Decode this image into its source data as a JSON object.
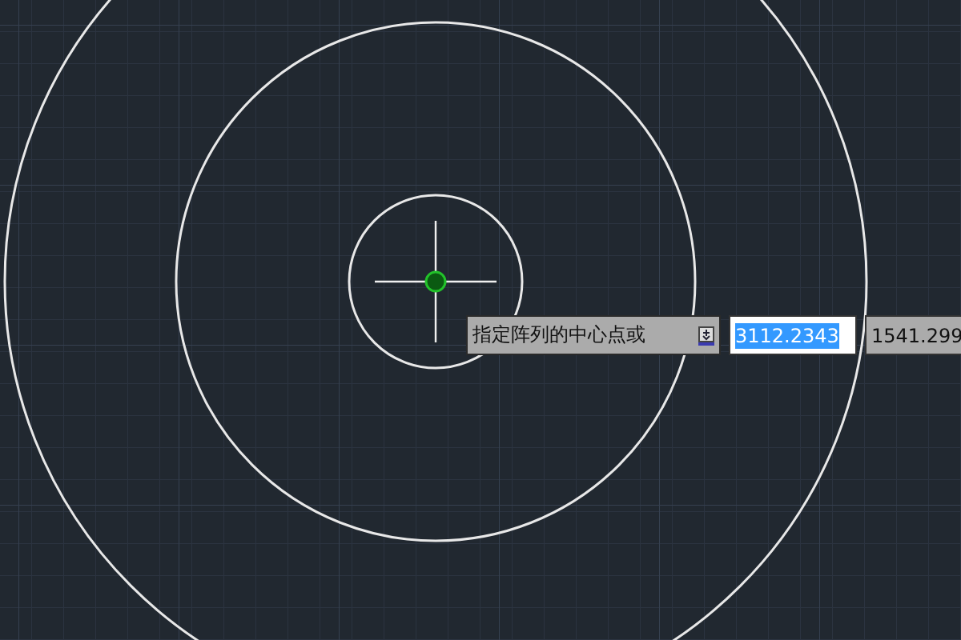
{
  "prompt": {
    "text": "指定阵列的中心点或"
  },
  "coordinate_fields": [
    {
      "value": "3112.2343",
      "selected": true
    },
    {
      "value": "1541.299",
      "selected": false
    }
  ]
}
